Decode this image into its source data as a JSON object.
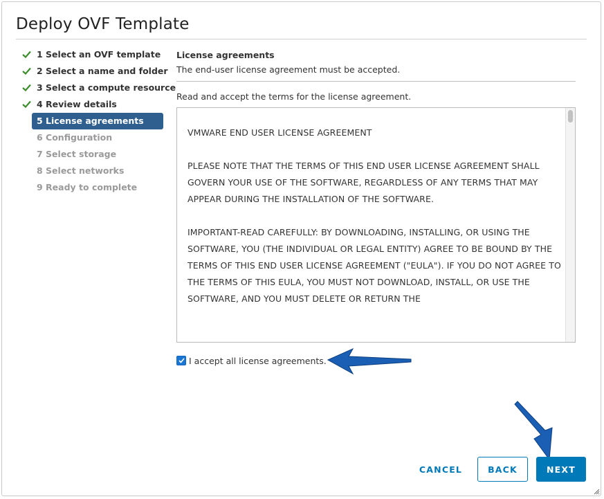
{
  "dialog": {
    "title": "Deploy OVF Template"
  },
  "steps": [
    {
      "label": "1 Select an OVF template",
      "state": "done"
    },
    {
      "label": "2 Select a name and folder",
      "state": "done"
    },
    {
      "label": "3 Select a compute resource",
      "state": "done"
    },
    {
      "label": "4 Review details",
      "state": "done"
    },
    {
      "label": "5 License agreements",
      "state": "active"
    },
    {
      "label": "6 Configuration",
      "state": "pending"
    },
    {
      "label": "7 Select storage",
      "state": "pending"
    },
    {
      "label": "8 Select networks",
      "state": "pending"
    },
    {
      "label": "9 Ready to complete",
      "state": "pending"
    }
  ],
  "content": {
    "section_title": "License agreements",
    "section_subtitle": "The end-user license agreement must be accepted.",
    "instructions": "Read and accept the terms for the license agreement.",
    "eula_paragraphs": [
      "VMWARE END USER LICENSE AGREEMENT",
      "PLEASE NOTE THAT THE TERMS OF THIS END USER LICENSE AGREEMENT SHALL GOVERN YOUR USE OF THE SOFTWARE, REGARDLESS OF ANY TERMS THAT MAY APPEAR DURING THE INSTALLATION OF THE SOFTWARE.",
      "IMPORTANT-READ CAREFULLY: BY DOWNLOADING, INSTALLING, OR USING THE SOFTWARE, YOU (THE INDIVIDUAL OR LEGAL ENTITY) AGREE TO BE BOUND BY THE TERMS OF THIS END USER LICENSE AGREEMENT (\"EULA\"). IF YOU DO NOT AGREE TO THE TERMS OF THIS EULA, YOU MUST NOT DOWNLOAD, INSTALL, OR USE THE SOFTWARE, AND YOU MUST DELETE OR RETURN THE"
    ],
    "accept_label": "I accept all license agreements.",
    "accept_checked": true
  },
  "footer": {
    "cancel_label": "CANCEL",
    "back_label": "BACK",
    "next_label": "NEXT"
  },
  "colors": {
    "active_step": "#2f5f8f",
    "primary": "#0079b8",
    "check_green": "#3c8c2c",
    "annotation_arrow": "#1a5fb4"
  },
  "icons": {
    "step_done": "check-icon",
    "checkbox": "checkmark-icon",
    "resize": "resize-grip-icon"
  }
}
